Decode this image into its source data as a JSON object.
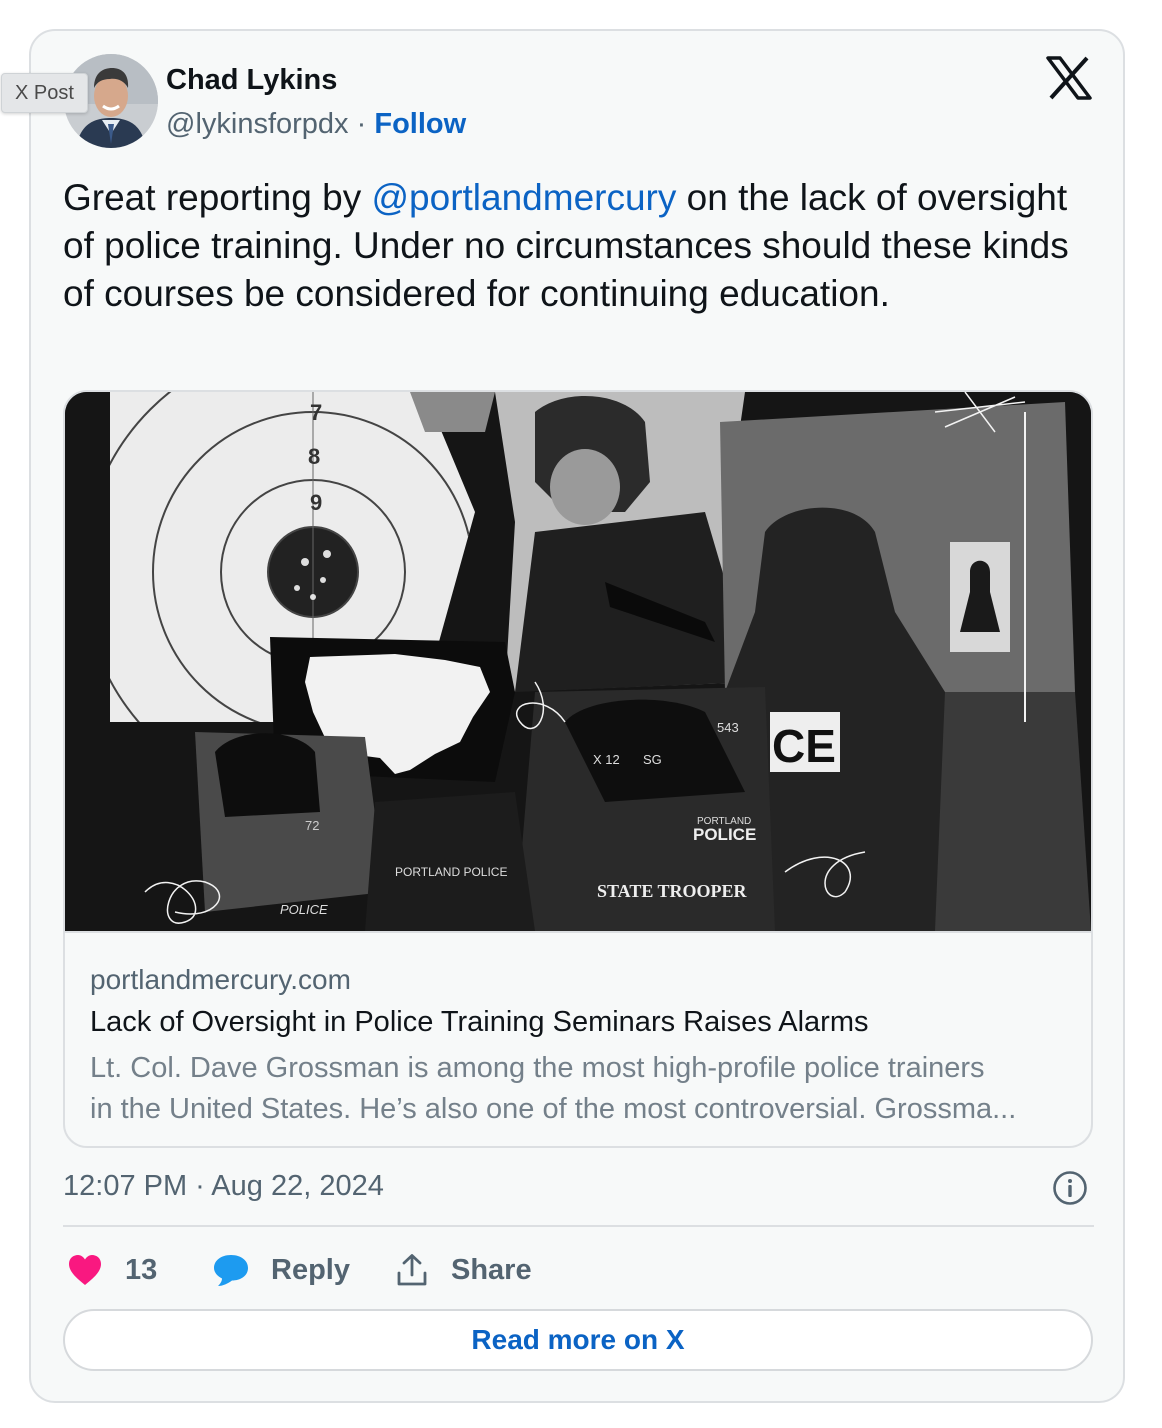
{
  "badge": "X Post",
  "author": {
    "name": "Chad Lykins",
    "handle": "@lykinsforpdx",
    "separator": "·",
    "follow_label": "Follow"
  },
  "tweet": {
    "text_before": "Great reporting by ",
    "mention": "@portlandmercury",
    "text_after": " on the lack of oversight of police training. Under no circumstances should these kinds of courses be considered for continuing education."
  },
  "link_card": {
    "domain": "portlandmercury.com",
    "title": "Lack of Oversight in Police Training Seminars Raises Alarms",
    "description_line1": "Lt. Col. Dave Grossman is among the most high-profile police trainers",
    "description_line2": "in the United States. He’s also one of the most controversial. Grossma...",
    "image": {
      "target_numbers": [
        "7",
        "8",
        "9"
      ],
      "labels": [
        "X 12",
        "SG",
        "543",
        "CE",
        "PORTLAND",
        "POLICE",
        "PORTLAND POLICE",
        "POLICE",
        "STATE TROOPER",
        "72"
      ]
    }
  },
  "timestamp": "12:07 PM · Aug 22, 2024",
  "actions": {
    "like_count": "13",
    "reply_label": "Reply",
    "share_label": "Share"
  },
  "read_more_label": "Read more on X",
  "colors": {
    "accent": "#0b63c4",
    "heart": "#f91880",
    "reply_bubble": "#1d9bf0",
    "muted": "#536471",
    "text": "#0f1419",
    "card_bg": "#f7f9f9"
  },
  "icons": [
    "x-logo-icon",
    "info-icon",
    "heart-icon",
    "reply-bubble-icon",
    "share-icon"
  ]
}
